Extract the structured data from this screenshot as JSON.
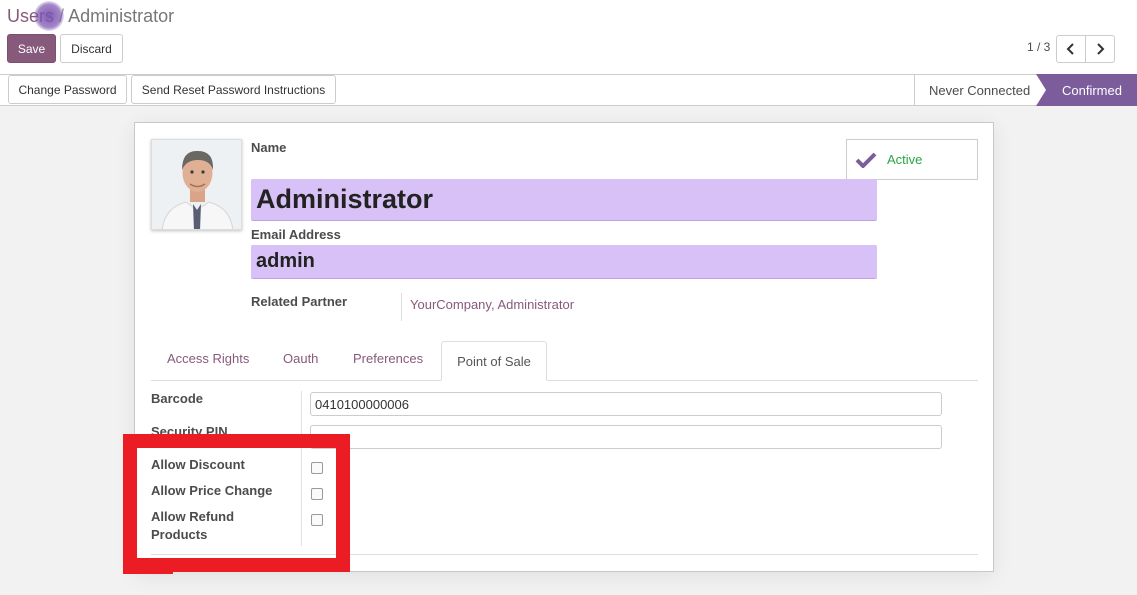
{
  "breadcrumb": {
    "parent": "Users",
    "separator": "/",
    "current": "Administrator"
  },
  "buttons": {
    "save": "Save",
    "discard": "Discard"
  },
  "pager": {
    "value": "1 / 3"
  },
  "header": {
    "change_password": "Change Password",
    "reset_password": "Send Reset Password Instructions",
    "statuses": [
      "Never Connected",
      "Confirmed"
    ],
    "active_status": "Confirmed"
  },
  "form": {
    "active_label": "Active",
    "name_label": "Name",
    "name_value": "Administrator",
    "email_label": "Email Address",
    "email_value": "admin",
    "partner_label": "Related Partner",
    "partner_value": "YourCompany, Administrator"
  },
  "tabs": [
    "Access Rights",
    "Oauth",
    "Preferences",
    "Point of Sale"
  ],
  "active_tab": "Point of Sale",
  "pos": {
    "barcode_label": "Barcode",
    "barcode_value": "0410100000006",
    "pin_label": "Security PIN",
    "pin_value": "",
    "allow_discount": "Allow Discount",
    "allow_price_change": "Allow Price Change",
    "allow_refund_line1": "Allow Refund",
    "allow_refund_line2": "Products",
    "allow_discount_checked": false,
    "allow_price_change_checked": false,
    "allow_refund_checked": false
  },
  "colors": {
    "brand": "#875a7b",
    "status_active": "#7c5c9a",
    "annotation": "#ec1c24",
    "field_highlight": "#d8c1f7"
  }
}
